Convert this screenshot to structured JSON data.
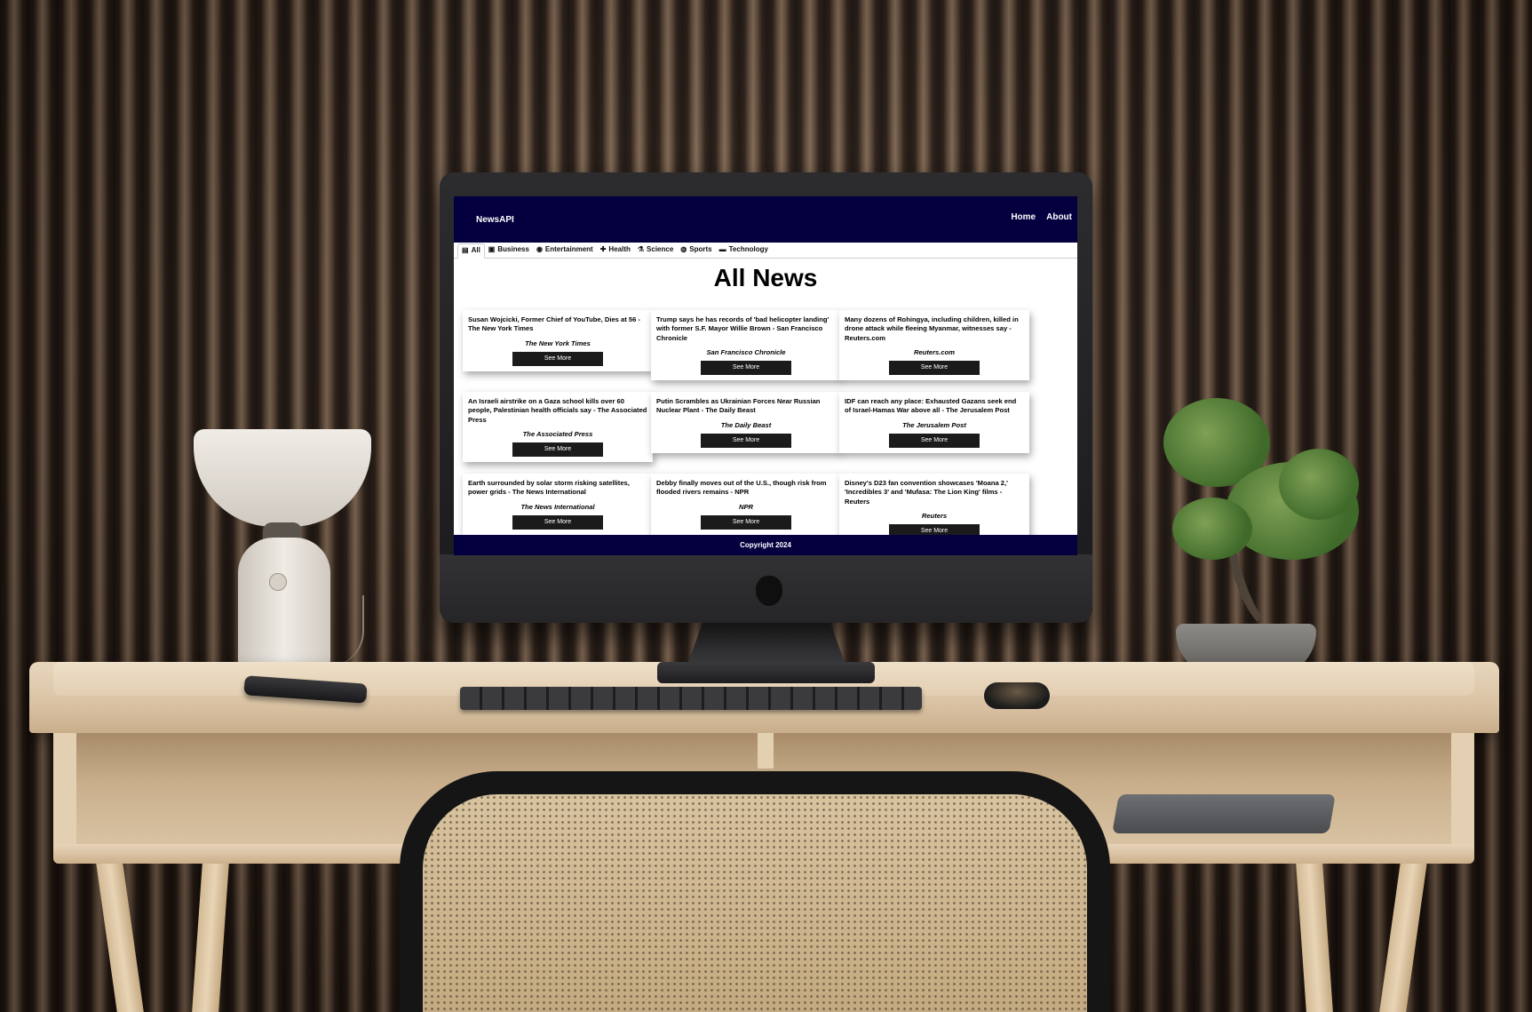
{
  "navbar": {
    "brand": "NewsAPI",
    "links": [
      "Home",
      "About"
    ]
  },
  "tabs": [
    {
      "label": "All",
      "icon": "newspaper-icon",
      "glyph": "▤",
      "active": true
    },
    {
      "label": "Business",
      "icon": "briefcase-icon",
      "glyph": "▣",
      "active": false
    },
    {
      "label": "Entertainment",
      "icon": "film-icon",
      "glyph": "◉",
      "active": false
    },
    {
      "label": "Health",
      "icon": "plus-icon",
      "glyph": "✚",
      "active": false
    },
    {
      "label": "Science",
      "icon": "flask-icon",
      "glyph": "⚗",
      "active": false
    },
    {
      "label": "Sports",
      "icon": "ball-icon",
      "glyph": "◍",
      "active": false
    },
    {
      "label": "Technology",
      "icon": "monitor-icon",
      "glyph": "▬",
      "active": false
    }
  ],
  "page_title": "All News",
  "articles": [
    {
      "title": "Susan Wojcicki, Former Chief of YouTube, Dies at 56 - The New York Times",
      "source": "The New York Times",
      "button": "See More"
    },
    {
      "title": "Trump says he has records of 'bad helicopter landing' with former S.F. Mayor Willie Brown - San Francisco Chronicle",
      "source": "San Francisco Chronicle",
      "button": "See More"
    },
    {
      "title": "Many dozens of Rohingya, including children, killed in drone attack while fleeing Myanmar, witnesses say - Reuters.com",
      "source": "Reuters.com",
      "button": "See More"
    },
    {
      "title": "An Israeli airstrike on a Gaza school kills over 60 people, Palestinian health officials say - The Associated Press",
      "source": "The Associated Press",
      "button": "See More"
    },
    {
      "title": "Putin Scrambles as Ukrainian Forces Near Russian Nuclear Plant - The Daily Beast",
      "source": "The Daily Beast",
      "button": "See More"
    },
    {
      "title": "IDF can reach any place: Exhausted Gazans seek end of Israel-Hamas War above all - The Jerusalem Post",
      "source": "The Jerusalem Post",
      "button": "See More"
    },
    {
      "title": "Earth surrounded by solar storm risking satellites, power grids - The News International",
      "source": "The News International",
      "button": "See More"
    },
    {
      "title": "Debby finally moves out of the U.S., though risk from flooded rivers remains - NPR",
      "source": "NPR",
      "button": "See More"
    },
    {
      "title": "Disney's D23 fan convention showcases 'Moana 2,' 'Incredibles 3' and 'Mufasa: The Lion King' films - Reuters",
      "source": "Reuters",
      "button": "See More"
    }
  ],
  "footer": "Copyright 2024",
  "colors": {
    "navbar": "#04003f",
    "button": "#1b1b1b"
  }
}
